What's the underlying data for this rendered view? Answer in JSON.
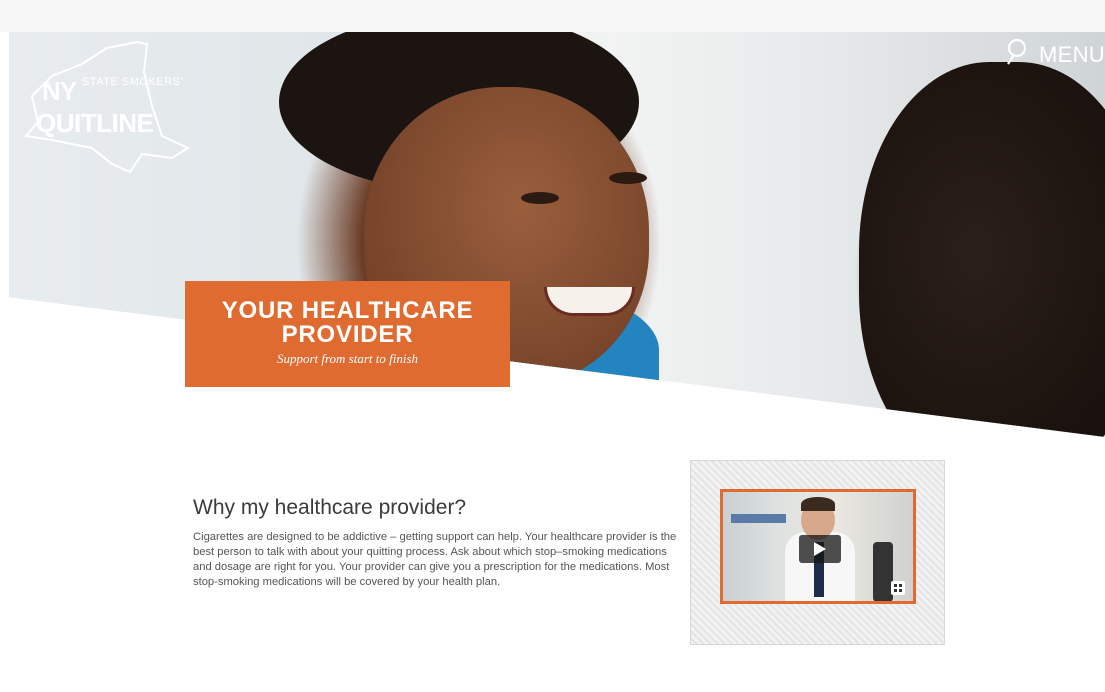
{
  "logo": {
    "line1": "NY",
    "line1b": "STATE SMOKERS'",
    "line2": "QUITLINE"
  },
  "header": {
    "menu_label": "MENU",
    "search_icon": "search-icon"
  },
  "banner": {
    "title": "YOUR HEALTHCARE PROVIDER",
    "subtitle": "Support from start to finish"
  },
  "main": {
    "heading": "Why my healthcare provider?",
    "body": "Cigarettes are designed to be addictive – getting support can help. Your healthcare provider is the best person to talk with about your quitting process. Ask about which stop–smoking medications and dosage are right for you. Your provider can give you a prescription for the medications. Most stop-smoking medications will be covered by your health plan."
  },
  "video": {
    "play_icon": "play-icon",
    "fullscreen_icon": "fullscreen-icon"
  },
  "colors": {
    "accent": "#e06b31"
  }
}
